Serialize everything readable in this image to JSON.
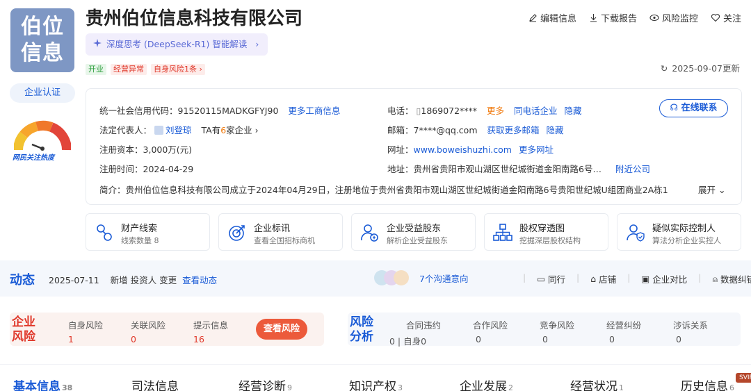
{
  "company": {
    "logo_text": [
      "伯位",
      "信息"
    ],
    "name": "贵州伯位信息科技有限公司",
    "ai_pill": "深度思考 (DeepSeek-R1) 智能解读",
    "tags": [
      "开业",
      "经营异常",
      "自身风险1条"
    ],
    "cert_label": "企业认证",
    "heat_label": "网民关注热度",
    "update_date": "2025-09-07更新"
  },
  "top_actions": [
    "编辑信息",
    "下载报告",
    "风险监控",
    "关注"
  ],
  "info": {
    "credit_code_label": "统一社会信用代码：",
    "credit_code": "91520115MADKGFYJ90",
    "more_biz": "更多工商信息",
    "legal_label": "法定代表人：",
    "legal_name": "刘登琼",
    "legal_companies_prefix": "TA有",
    "legal_companies_count": "6",
    "legal_companies_suffix": "家企业",
    "capital_label": "注册资本：",
    "capital": "3,000万(元)",
    "reg_date_label": "注册时间：",
    "reg_date": "2024-04-29",
    "phone_label": "电话：",
    "phone": "1869072****",
    "phone_more": "更多",
    "phone_same": "同电话企业",
    "phone_hide": "隐藏",
    "email_label": "邮箱：",
    "email": "7****@qq.com",
    "email_more": "获取更多邮箱",
    "email_hide": "隐藏",
    "web_label": "网址：",
    "website": "www.boweishuzhi.com",
    "web_more": "更多网址",
    "addr_label": "地址：",
    "address": "贵州省贵阳市观山湖区世纪城街道金阳南路6号…",
    "nearby": "附近公司",
    "intro_label": "简介：",
    "intro": "贵州伯位信息科技有限公司成立于2024年04月29日，注册地位于贵州省贵阳市观山湖区世纪城街道金阳南路6号贵阳世纪城U组团商业2A栋1",
    "expand": "展开",
    "online_contact": "在线联系"
  },
  "features": [
    {
      "title": "财产线索",
      "sub": "线索数量 8",
      "icon": "property-clue-icon"
    },
    {
      "title": "企业标讯",
      "sub": "查看全国招标商机",
      "icon": "bid-target-icon"
    },
    {
      "title": "企业受益股东",
      "sub": "解析企业受益股东",
      "icon": "beneficiary-icon"
    },
    {
      "title": "股权穿透图",
      "sub": "挖掘深层股权结构",
      "icon": "equity-chart-icon"
    },
    {
      "title": "疑似实际控制人",
      "sub": "算法分析企业实控人",
      "icon": "controller-icon"
    }
  ],
  "dynamics": {
    "title": "动态",
    "date": "2025-07-11",
    "text": "新增 投资人 变更",
    "link": "查看动态",
    "intent": "7个沟通意向",
    "tools": [
      "同行",
      "店铺",
      "企业对比",
      "数据纠错"
    ]
  },
  "risk": {
    "title_lines": [
      "企业",
      "风险"
    ],
    "items": [
      {
        "label": "自身风险",
        "value": "1"
      },
      {
        "label": "关联风险",
        "value": "0"
      },
      {
        "label": "提示信息",
        "value": "16"
      }
    ],
    "button": "查看风险"
  },
  "analysis": {
    "title_lines": [
      "风险",
      "分析"
    ],
    "items": [
      {
        "label": "合同违约",
        "value": "0 | 自身0"
      },
      {
        "label": "合作风险",
        "value": "0"
      },
      {
        "label": "竞争风险",
        "value": "0"
      },
      {
        "label": "经营纠纷",
        "value": "0"
      },
      {
        "label": "涉诉关系",
        "value": "0"
      }
    ]
  },
  "tabs": [
    {
      "label": "基本信息",
      "count": "38"
    },
    {
      "label": "司法信息",
      "count": ""
    },
    {
      "label": "经营诊断",
      "count": "9"
    },
    {
      "label": "知识产权",
      "count": "3"
    },
    {
      "label": "企业发展",
      "count": "2"
    },
    {
      "label": "经营状况",
      "count": "1"
    },
    {
      "label": "历史信息",
      "count": "6"
    }
  ],
  "svip": "SVIP",
  "colors": {
    "brand": "#1a5bd6",
    "risk": "#e0382a",
    "logo_bg": "#7e97c4",
    "orange": "#f0780a"
  }
}
